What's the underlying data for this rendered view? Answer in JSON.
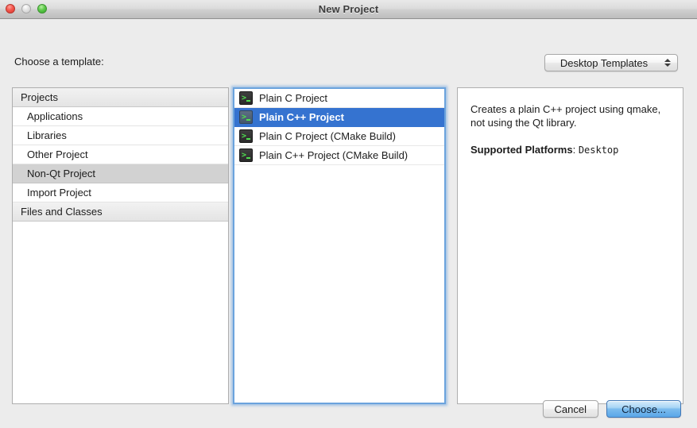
{
  "window": {
    "title": "New Project",
    "traffic_lights": [
      "close",
      "minimize",
      "zoom"
    ]
  },
  "header": {
    "choose_label": "Choose a template:",
    "template_filter": {
      "selected": "Desktop Templates"
    }
  },
  "sidebar": {
    "groups": [
      {
        "header": "Projects",
        "items": [
          {
            "label": "Applications",
            "selected": false
          },
          {
            "label": "Libraries",
            "selected": false
          },
          {
            "label": "Other Project",
            "selected": false
          },
          {
            "label": "Non-Qt Project",
            "selected": true
          },
          {
            "label": "Import Project",
            "selected": false
          }
        ]
      },
      {
        "header": "Files and Classes",
        "items": []
      }
    ]
  },
  "templates": {
    "items": [
      {
        "label": "Plain C Project",
        "icon": "terminal-icon",
        "selected": false
      },
      {
        "label": "Plain C++ Project",
        "icon": "terminal-icon",
        "selected": true
      },
      {
        "label": "Plain C Project (CMake Build)",
        "icon": "terminal-icon",
        "selected": false
      },
      {
        "label": "Plain C++ Project (CMake Build)",
        "icon": "terminal-icon",
        "selected": false
      }
    ]
  },
  "description": {
    "text": "Creates a plain C++ project using qmake, not using the Qt library.",
    "platforms_key": "Supported Platforms",
    "platforms_sep": ": ",
    "platforms_value": "Desktop"
  },
  "footer": {
    "cancel_label": "Cancel",
    "choose_label": "Choose..."
  },
  "colors": {
    "selection_active": "#3573d0",
    "selection_inactive": "#d2d2d2",
    "focus_ring": "#6ba3dd",
    "window_background": "#ececec",
    "default_button": "#5aa7e8"
  }
}
